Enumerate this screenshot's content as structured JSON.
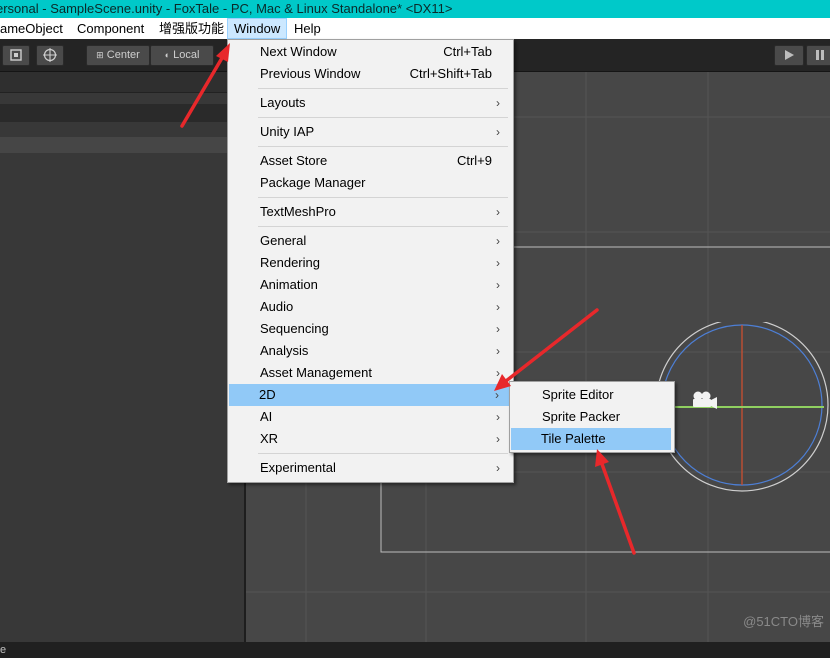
{
  "window": {
    "title": "ersonal - SampleScene.unity - FoxTale - PC, Mac & Linux Standalone* <DX11>"
  },
  "menubar": {
    "items": [
      "ameObject",
      "Component",
      "增强版功能",
      "Window",
      "Help"
    ],
    "active": "Window"
  },
  "toolbar": {
    "pivot_label": "Center",
    "space_label": "Local"
  },
  "window_menu": {
    "items": [
      {
        "label": "Next Window",
        "shortcut": "Ctrl+Tab"
      },
      {
        "label": "Previous Window",
        "shortcut": "Ctrl+Shift+Tab"
      },
      {
        "label": "Layouts",
        "submenu": true
      },
      {
        "label": "Unity IAP",
        "submenu": true
      },
      {
        "label": "Asset Store",
        "shortcut": "Ctrl+9"
      },
      {
        "label": "Package Manager"
      },
      {
        "label": "TextMeshPro",
        "submenu": true
      },
      {
        "label": "General",
        "submenu": true
      },
      {
        "label": "Rendering",
        "submenu": true
      },
      {
        "label": "Animation",
        "submenu": true
      },
      {
        "label": "Audio",
        "submenu": true
      },
      {
        "label": "Sequencing",
        "submenu": true
      },
      {
        "label": "Analysis",
        "submenu": true
      },
      {
        "label": "Asset Management",
        "submenu": true
      },
      {
        "label": "2D",
        "submenu": true,
        "highlighted": true
      },
      {
        "label": "AI",
        "submenu": true
      },
      {
        "label": "XR",
        "submenu": true
      },
      {
        "label": "Experimental",
        "submenu": true
      }
    ],
    "submenu_arrow": "›"
  },
  "submenu_2d": {
    "items": [
      {
        "label": "Sprite Editor"
      },
      {
        "label": "Sprite Packer"
      },
      {
        "label": "Tile Palette",
        "highlighted": true
      }
    ]
  },
  "status": {
    "left_text": "e"
  },
  "watermark": "@51CTO博客",
  "colors": {
    "title_bar": "#00c9c9",
    "menu_highlight": "#91c9f7",
    "annotation_arrow": "#e8282b",
    "scene_background": "#474747"
  }
}
